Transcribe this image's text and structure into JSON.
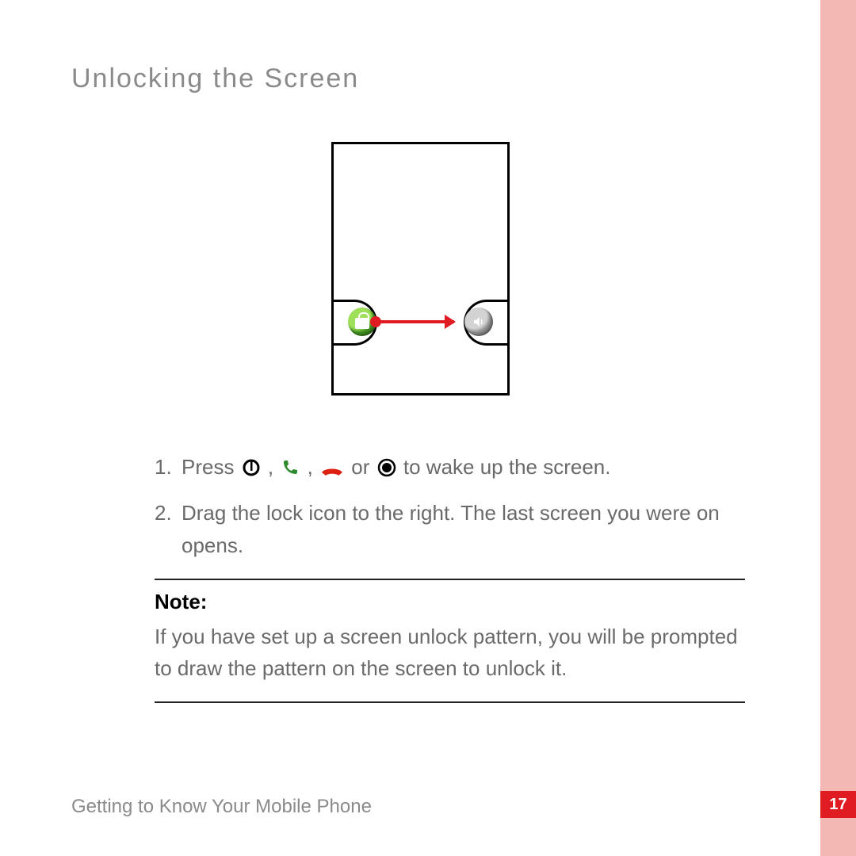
{
  "title": "Unlocking  the  Screen",
  "footer": "Getting to Know Your Mobile Phone",
  "page_number": "17",
  "steps": {
    "s1_num": "1.",
    "s1_pre": "Press ",
    "s1_sep1": ", ",
    "s1_sep2": ", ",
    "s1_mid": " or",
    "s1_post": " to wake up the screen.",
    "s2_num": "2.",
    "s2_txt": "Drag the lock icon to the right. The last screen you were on opens."
  },
  "note": {
    "label": "Note:",
    "body": "If you have set up a screen unlock pattern, you will be prompted to draw the pattern on the screen to unlock it."
  },
  "icons": {
    "power": "power-icon",
    "call": "phone-green-icon",
    "end": "phone-red-icon",
    "center": "dot-circle-icon",
    "lock": "lock-icon",
    "sound": "sound-icon"
  }
}
